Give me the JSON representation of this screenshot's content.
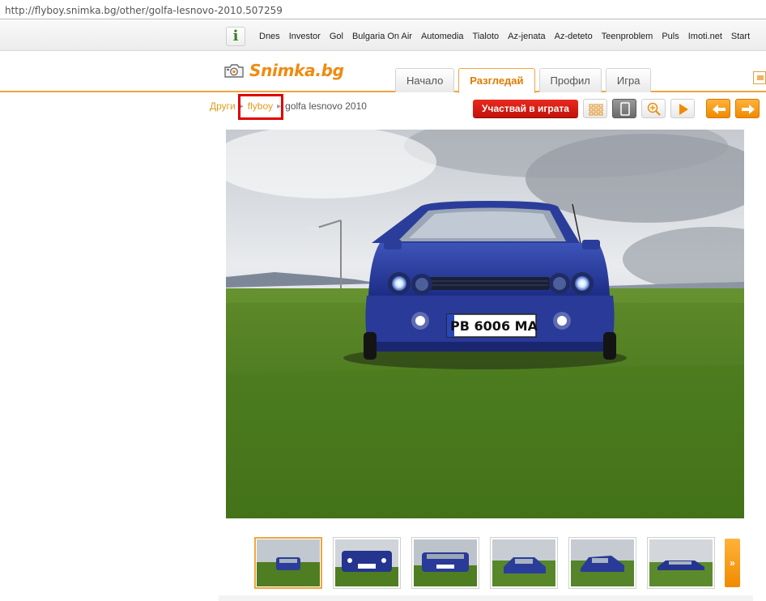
{
  "address_bar": {
    "url": "http://flyboy.snimka.bg/other/golfa-lesnovo-2010.507259"
  },
  "portal_bar": {
    "icon_letter": "i",
    "links": [
      "Dnes",
      "Investor",
      "Gol",
      "Bulgaria On Air",
      "Automedia",
      "Tialoto",
      "Az-jenata",
      "Az-deteto",
      "Teenproblem",
      "Puls",
      "Imoti.net",
      "Start"
    ]
  },
  "header": {
    "logo_text": "Snimka.bg",
    "tabs": [
      {
        "label": "Начало",
        "active": false
      },
      {
        "label": "Разгледай",
        "active": true
      },
      {
        "label": "Профил",
        "active": false
      },
      {
        "label": "Игра",
        "active": false
      }
    ]
  },
  "breadcrumb": {
    "category": "Други",
    "user": "flyboy",
    "current": "golfa lesnovo 2010"
  },
  "toolbar": {
    "play_game_label": "Участвай в играта",
    "icons": [
      "grid-view-icon",
      "single-view-icon",
      "zoom-icon",
      "slideshow-play-icon",
      "previous-arrow-icon",
      "next-arrow-icon"
    ]
  },
  "photo": {
    "license_plate": "PB 6006 MA"
  },
  "thumbnails": {
    "count": 6,
    "active_index": 0,
    "more_label": "»"
  },
  "colors": {
    "accent": "#f0a53c",
    "logo": "#f08a10",
    "play_button": "#d41a10",
    "highlight": "#e00000"
  }
}
